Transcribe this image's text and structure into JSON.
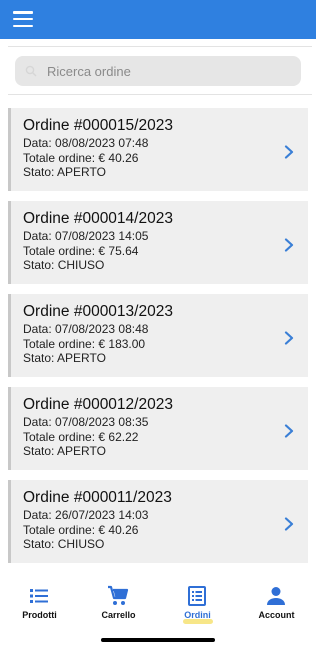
{
  "header": {
    "menu_icon": "hamburger-menu-icon",
    "color": "#2f80e0"
  },
  "search": {
    "placeholder": "Ricerca ordine",
    "value": ""
  },
  "orders": [
    {
      "title": "Ordine #000015/2023",
      "date": "Data: 08/08/2023 07:48",
      "total": "Totale ordine: € 40.26",
      "status": "Stato: APERTO",
      "state": "open"
    },
    {
      "title": "Ordine #000014/2023",
      "date": "Data: 07/08/2023 14:05",
      "total": "Totale ordine: € 75.64",
      "status": "Stato: CHIUSO",
      "state": "closed"
    },
    {
      "title": "Ordine #000013/2023",
      "date": "Data: 07/08/2023 08:48",
      "total": "Totale ordine: € 183.00",
      "status": "Stato: APERTO",
      "state": "open"
    },
    {
      "title": "Ordine #000012/2023",
      "date": "Data: 07/08/2023 08:35",
      "total": "Totale ordine: € 62.22",
      "status": "Stato: APERTO",
      "state": "open"
    },
    {
      "title": "Ordine #000011/2023",
      "date": "Data: 26/07/2023 14:03",
      "total": "Totale ordine: € 40.26",
      "status": "Stato: CHIUSO",
      "state": "closed"
    }
  ],
  "status_colors": {
    "open": "#c8c8c8",
    "closed": "#4caf50"
  },
  "tabs": [
    {
      "label": "Prodotti",
      "icon": "list-icon"
    },
    {
      "label": "Carrello",
      "icon": "cart-icon"
    },
    {
      "label": "Ordini",
      "icon": "receipt-icon",
      "active": true
    },
    {
      "label": "Account",
      "icon": "person-icon"
    }
  ],
  "accent_color": "#2f6fd6"
}
